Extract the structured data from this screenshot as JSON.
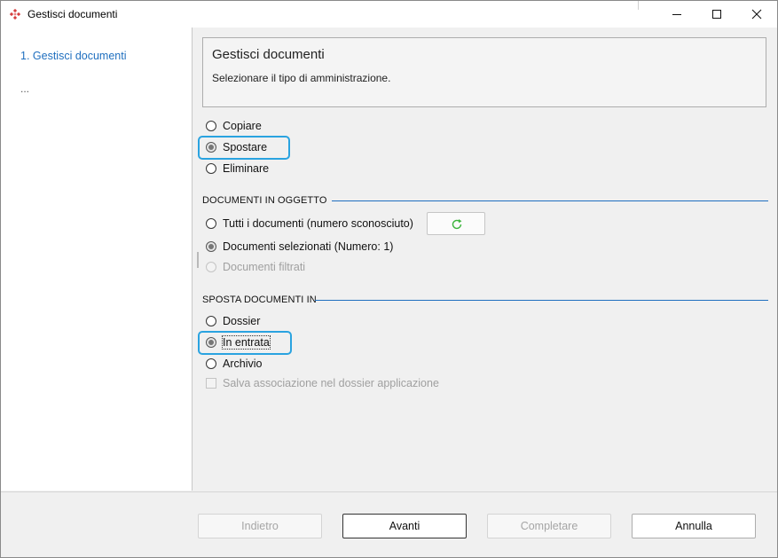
{
  "window": {
    "title": "Gestisci documenti",
    "icon": "red-diamond-app-icon"
  },
  "sidebar": {
    "steps": [
      {
        "label": "1. Gestisci documenti",
        "active": true
      },
      {
        "label": "..."
      }
    ]
  },
  "header": {
    "title": "Gestisci documenti",
    "subtitle": "Selezionare il tipo di amministrazione."
  },
  "admin_type": {
    "options": [
      {
        "label": "Copiare",
        "checked": false
      },
      {
        "label": "Spostare",
        "checked": true,
        "focused": true
      },
      {
        "label": "Eliminare",
        "checked": false
      }
    ]
  },
  "documents_section": {
    "title": "DOCUMENTI IN OGGETTO",
    "options": [
      {
        "label": "Tutti i documenti (numero sconosciuto)",
        "checked": false
      },
      {
        "label": "Documenti selezionati (Numero: 1)",
        "checked": true
      },
      {
        "label": "Documenti filtrati",
        "checked": false,
        "disabled": true
      }
    ],
    "refresh_icon": "refresh-icon"
  },
  "move_section": {
    "title": "SPOSTA DOCUMENTI IN",
    "options": [
      {
        "label": "Dossier",
        "checked": false
      },
      {
        "label": "In entrata",
        "checked": true,
        "focused": true
      },
      {
        "label": "Archivio",
        "checked": false
      }
    ],
    "save_association_label": "Salva associazione nel dossier applicazione"
  },
  "footer": {
    "back_label": "Indietro",
    "next_label": "Avanti",
    "finish_label": "Completare",
    "cancel_label": "Annulla"
  },
  "colors": {
    "accent": "#1f6fbf",
    "focus": "#2aa3e0",
    "refresh_green": "#3cb43c"
  }
}
